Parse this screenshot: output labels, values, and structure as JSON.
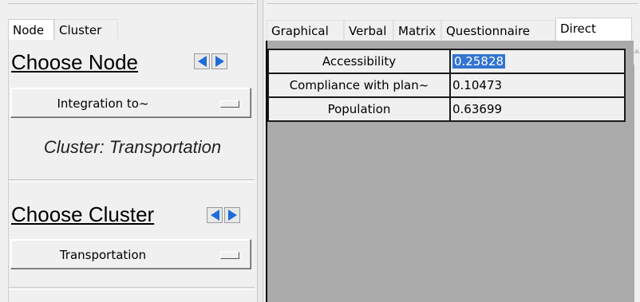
{
  "left_tabs": [
    "Node",
    "Cluster"
  ],
  "left_panel": {
    "choose_node_title": "Choose Node",
    "node_combo_value": "Integration to~",
    "cluster_caption": "Cluster: Transportation",
    "choose_cluster_title": "Choose Cluster",
    "cluster_combo_value": "Transportation"
  },
  "right_tabs": [
    "Graphical",
    "Verbal",
    "Matrix",
    "Questionnaire",
    "Direct"
  ],
  "active_right_tab": "Direct",
  "rows": [
    {
      "name": "Accessibility",
      "value": "0.25828"
    },
    {
      "name": "Compliance with plan~",
      "value": "0.10473"
    },
    {
      "name": "Population",
      "value": "0.63699"
    }
  ],
  "colors": {
    "arrow": "#1e6cd8",
    "selection": "#3374d0",
    "grid_background": "#aaaaaa"
  },
  "icons": {
    "prev": "triangle-left",
    "next": "triangle-right"
  }
}
